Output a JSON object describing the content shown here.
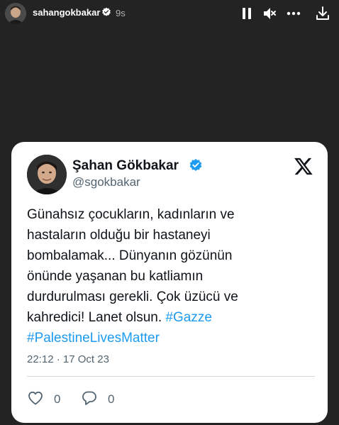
{
  "story": {
    "username": "sahangokbakar",
    "time_ago": "9s",
    "icons": {
      "avatar": "profile-photo",
      "verified": "verified-badge-icon",
      "pause": "pause-icon",
      "mute": "speaker-muted-icon",
      "more": "more-horizontal-icon",
      "download": "download-icon"
    }
  },
  "tweet": {
    "display_name": "Şahan Gökbakar",
    "handle": "@sgokbakar",
    "text_lines": [
      "Günahsız çocukların, kadınların ve",
      "hastaların olduğu bir hastaneyi",
      "bombalamak... Dünyanın gözünün",
      "önünde yaşanan bu katliamın",
      "durdurulması gerekli. Çok üzücü ve",
      "kahredici! Lanet olsun. "
    ],
    "hashtag_1": "#Gazze",
    "hashtag_2": "#PalestineLivesMatter",
    "timestamp": "22:12 · 17 Oct 23",
    "likes": "0",
    "replies": "0"
  },
  "colors": {
    "background": "#232323",
    "card": "#ffffff",
    "hashtag": "#1d9bf0",
    "verified": "#1d9bf0",
    "secondary_text": "#536471"
  }
}
